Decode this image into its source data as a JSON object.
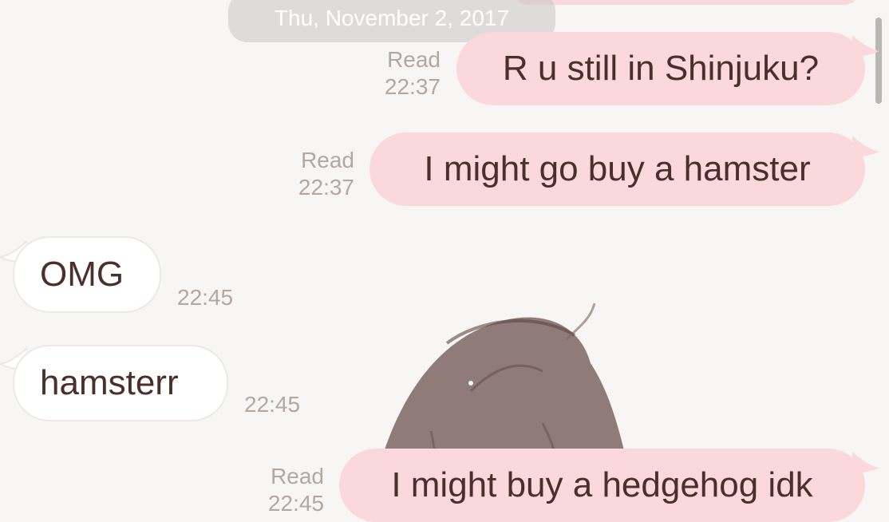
{
  "date_separator": "Thu, November 2, 2017",
  "messages": [
    {
      "direction": "sent",
      "text": "R u still in Shinjuku?",
      "status": "Read",
      "time": "22:37"
    },
    {
      "direction": "sent",
      "text": "I might go buy a hamster",
      "status": "Read",
      "time": "22:37"
    },
    {
      "direction": "received",
      "text": "OMG",
      "time": "22:45"
    },
    {
      "direction": "received",
      "text": "hamsterr",
      "time": "22:45"
    },
    {
      "direction": "sent",
      "text": "I might buy a hedgehog idk",
      "status": "Read",
      "time": "22:45"
    }
  ],
  "colors": {
    "background": "#f8f6f4",
    "sent_bubble": "#fbd8dc",
    "received_bubble": "#ffffff",
    "message_text": "#4a2f2a",
    "meta_text": "#b2a8a3"
  },
  "icons": {
    "background_art": "anime-hair-illustration",
    "scrollbar": "scroll-indicator"
  }
}
